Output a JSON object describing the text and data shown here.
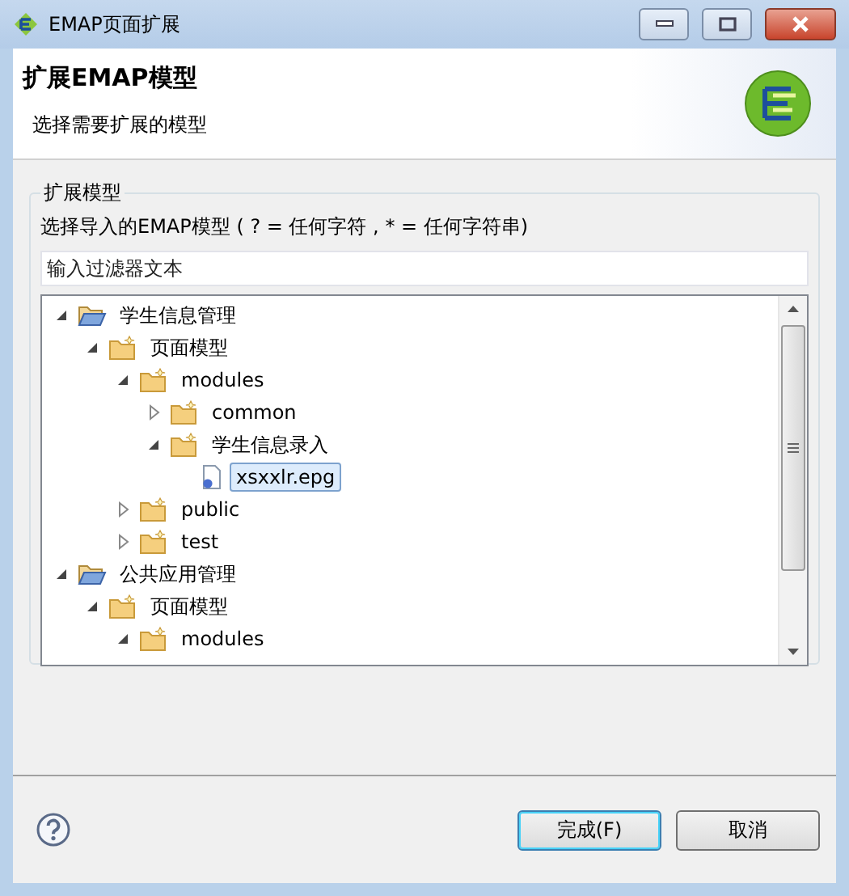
{
  "window": {
    "title": "EMAP页面扩展"
  },
  "header": {
    "title": "扩展EMAP模型",
    "subtitle": "选择需要扩展的模型"
  },
  "group": {
    "title": "扩展模型",
    "instruction": "选择导入的EMAP模型 ( ? = 任何字符 , * = 任何字符串)",
    "filter": {
      "placeholder": "输入过滤器文本"
    },
    "tree": [
      {
        "label": "学生信息管理",
        "kind": "project",
        "expanded": true,
        "selected": false,
        "children": [
          {
            "label": "页面模型",
            "kind": "folder",
            "expanded": true,
            "selected": false,
            "children": [
              {
                "label": "modules",
                "kind": "folder",
                "expanded": true,
                "selected": false,
                "children": [
                  {
                    "label": "common",
                    "kind": "folder",
                    "expanded": false,
                    "selected": false
                  },
                  {
                    "label": "学生信息录入",
                    "kind": "folder",
                    "expanded": true,
                    "selected": false,
                    "children": [
                      {
                        "label": "xsxxlr.epg",
                        "kind": "file",
                        "selected": true
                      }
                    ]
                  }
                ]
              },
              {
                "label": "public",
                "kind": "folder",
                "expanded": false,
                "selected": false
              },
              {
                "label": "test",
                "kind": "folder",
                "expanded": false,
                "selected": false
              }
            ]
          }
        ]
      },
      {
        "label": "公共应用管理",
        "kind": "project",
        "expanded": true,
        "selected": false,
        "children": [
          {
            "label": "页面模型",
            "kind": "folder",
            "expanded": true,
            "selected": false,
            "children": [
              {
                "label": "modules",
                "kind": "folder",
                "expanded": true,
                "selected": false
              }
            ]
          }
        ]
      }
    ]
  },
  "buttons": [
    {
      "label": "完成(F)",
      "kind": "default"
    },
    {
      "label": "取消",
      "kind": "normal"
    }
  ]
}
